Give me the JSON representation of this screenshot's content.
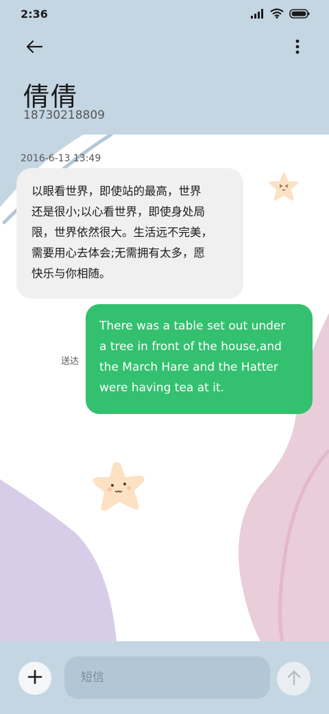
{
  "status_bar": {
    "time": "2:36",
    "icons": [
      "signal-icon",
      "wifi-icon",
      "battery-icon"
    ]
  },
  "header": {
    "back_icon": "arrow-left-icon",
    "more_icon": "more-vertical-icon",
    "contact_name": "倩倩",
    "contact_number": "18730218809"
  },
  "conversation": {
    "timestamp": "2016-6-13 13:49",
    "messages": [
      {
        "direction": "incoming",
        "lines": [
          "以眼看世界，即使站的最高，世界",
          "还是很小;以心看世界，即使身处局",
          "限，世界依然很大。生活远不完美，",
          "需要用心去体会;无需拥有太多，愿",
          "快乐与你相随。"
        ]
      },
      {
        "direction": "outgoing",
        "lines": [
          "There was a table set out under",
          "a tree in front of the house,and",
          "the March Hare and the Hatter",
          "were having tea at it."
        ],
        "status": "送达"
      }
    ]
  },
  "composer": {
    "add_icon": "plus-icon",
    "placeholder": "短信",
    "send_icon": "arrow-up-icon"
  },
  "colors": {
    "background": "#c5d6e3",
    "outgoing_bubble": "#33c06f",
    "incoming_bubble": "#f0f0f0",
    "pink_wave": "#e9cdd8",
    "purple_wave": "#d8cde9"
  }
}
